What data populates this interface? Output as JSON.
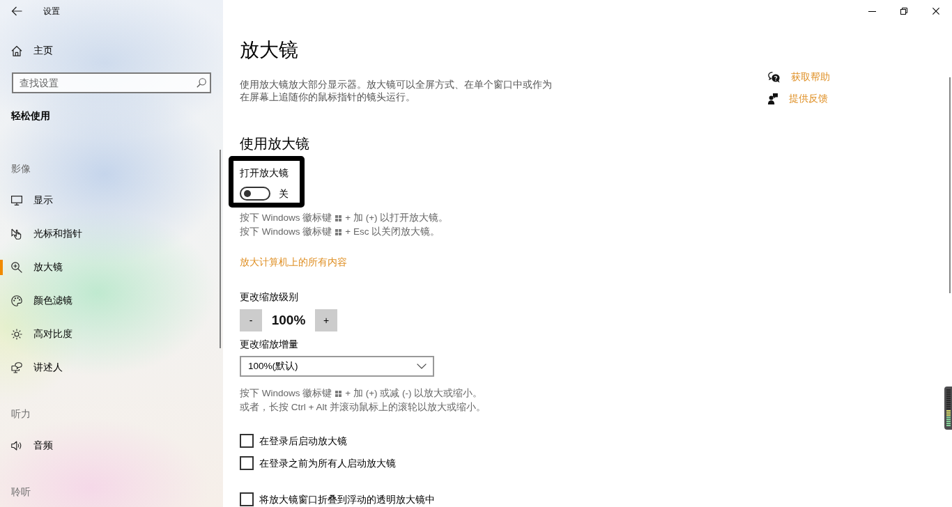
{
  "window": {
    "title": "设置"
  },
  "sidebar": {
    "home": "主页",
    "search": {
      "placeholder": "查找设置"
    },
    "category": "轻松使用",
    "sections": [
      {
        "heading": "影像",
        "items": [
          {
            "kind": "display",
            "label": "显示",
            "selected": false
          },
          {
            "kind": "pointer",
            "label": "光标和指针",
            "selected": false
          },
          {
            "kind": "magnifier",
            "label": "放大镜",
            "selected": true
          },
          {
            "kind": "palette",
            "label": "颜色滤镜",
            "selected": false
          },
          {
            "kind": "contrast",
            "label": "高对比度",
            "selected": false
          },
          {
            "kind": "narrator",
            "label": "讲述人",
            "selected": false
          }
        ]
      },
      {
        "heading": "听力",
        "items": [
          {
            "kind": "audio",
            "label": "音频",
            "selected": false
          }
        ]
      },
      {
        "heading": "聆听"
      }
    ]
  },
  "page": {
    "title": "放大镜",
    "description": "使用放大镜放大部分显示器。放大镜可以全屏方式、在单个窗口中或作为在屏幕上追随你的鼠标指针的镜头运行。",
    "help_links": [
      {
        "kind": "help",
        "label": "获取帮助"
      },
      {
        "kind": "feedback",
        "label": "提供反馈"
      }
    ],
    "section_title": "使用放大镜",
    "toggle": {
      "label": "打开放大镜",
      "on": false,
      "state_text": "关",
      "highlighted": true
    },
    "toggle_hints": [
      {
        "kind": "key",
        "before": "按下 Windows 徽标键",
        "after": "+ 加 (+) 以打开放大镜。"
      },
      {
        "kind": "key",
        "before": "按下 Windows 徽标键",
        "after": "+ Esc 以关闭放大镜。"
      }
    ],
    "link": "放大计算机上的所有内容",
    "zoom_level": {
      "label": "更改缩放级别",
      "decrease": "-",
      "value": "100%",
      "increase": "+"
    },
    "zoom_increment": {
      "label": "更改缩放增量",
      "value": "100%(默认)"
    },
    "zoom_hints": [
      {
        "kind": "key",
        "before": "按下 Windows 徽标键",
        "after": "+ 加 (+) 或减 (-) 以放大或缩小。"
      },
      {
        "kind": "plain",
        "text": "或者，长按 Ctrl + Alt 并滚动鼠标上的滚轮以放大或缩小。"
      }
    ],
    "checkboxes": [
      {
        "label": "在登录后启动放大镜",
        "checked": false
      },
      {
        "label": "在登录之前为所有人启动放大镜",
        "checked": false
      },
      {
        "label": "将放大镜窗口折叠到浮动的透明放大镜中",
        "checked": false
      }
    ]
  }
}
